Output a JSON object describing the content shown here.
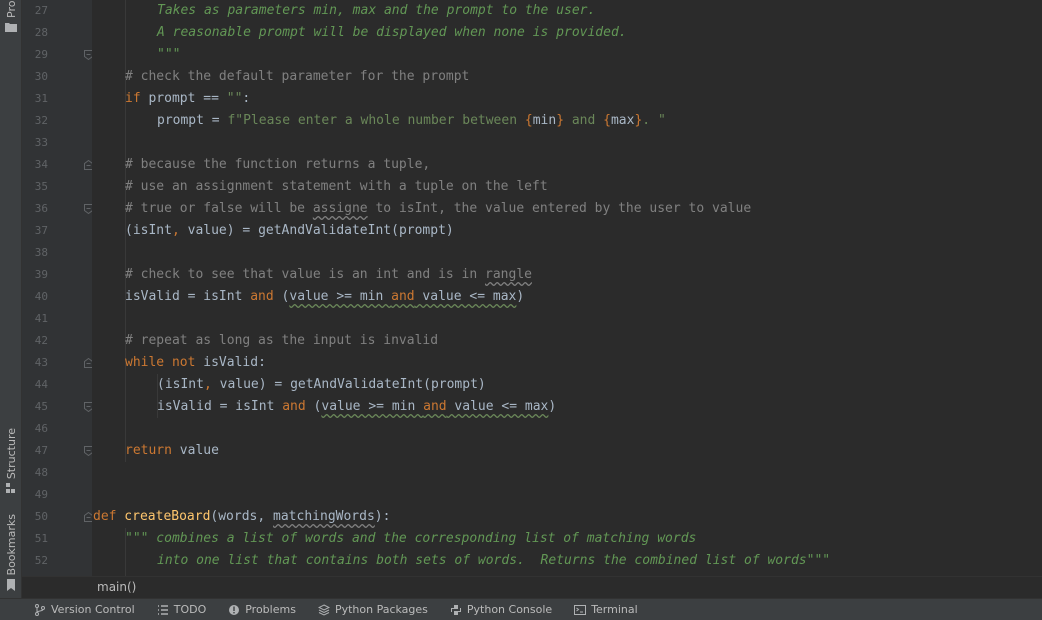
{
  "left_strip": {
    "project_label": "Pro",
    "structure_label": "Structure",
    "bookmarks_label": "Bookmarks"
  },
  "lines": [
    {
      "n": "27"
    },
    {
      "n": "28"
    },
    {
      "n": "29"
    },
    {
      "n": "30"
    },
    {
      "n": "31"
    },
    {
      "n": "32"
    },
    {
      "n": "33"
    },
    {
      "n": "34"
    },
    {
      "n": "35"
    },
    {
      "n": "36"
    },
    {
      "n": "37"
    },
    {
      "n": "38"
    },
    {
      "n": "39"
    },
    {
      "n": "40"
    },
    {
      "n": "41"
    },
    {
      "n": "42"
    },
    {
      "n": "43"
    },
    {
      "n": "44"
    },
    {
      "n": "45"
    },
    {
      "n": "46"
    },
    {
      "n": "47"
    },
    {
      "n": "48"
    },
    {
      "n": "49"
    },
    {
      "n": "50"
    },
    {
      "n": "51"
    },
    {
      "n": "52"
    }
  ],
  "code": {
    "l27": "Takes as parameters min, max and the prompt to the user.",
    "l28": "A reasonable prompt will be displayed when none is provided.",
    "l29": "\"\"\"",
    "l30": "# check the default parameter for the prompt",
    "l31_kw": "if",
    "l31_rest": " prompt == ",
    "l31_str": "\"\"",
    "l31_end": ":",
    "l32_a": "prompt = ",
    "l32_s1": "f\"Please enter a whole number between ",
    "l32_b1": "{",
    "l32_v1": "min",
    "l32_b2": "}",
    "l32_s2": " and ",
    "l32_b3": "{",
    "l32_v2": "max",
    "l32_b4": "}",
    "l32_s3": ". \"",
    "l34": "# because the function returns a tuple,",
    "l35": "# use an assignment statement with a tuple on the left",
    "l36_a": "# true or false will be ",
    "l36_sq": "assigne",
    "l36_b": " to isInt, the value entered by the user to value",
    "l37_a": "(isInt",
    "l37_c": ",",
    "l37_b": " value) = getAndValidateInt(prompt)",
    "l39_a": "# check to see that value is an int and is in ",
    "l39_sq": "rangle",
    "l40_a": "isValid = isInt ",
    "l40_kw1": "and",
    "l40_b": " (",
    "l40_sq1": "value >= min ",
    "l40_kw2": "and",
    "l40_sq2": " value <= max",
    "l40_c": ")",
    "l42": "# repeat as long as the input is invalid",
    "l43_kw": "while not",
    "l43_rest": " isValid:",
    "l44_a": "(isInt",
    "l44_c": ",",
    "l44_b": " value) = getAndValidateInt(prompt)",
    "l45_a": "isValid = isInt ",
    "l45_kw1": "and",
    "l45_b": " (",
    "l45_sq1": "value >= min ",
    "l45_kw2": "and",
    "l45_sq2": " value <= max",
    "l45_c": ")",
    "l47_kw": "return",
    "l47_rest": " value",
    "l50_kw": "def",
    "l50_fn": " createBoard",
    "l50_a": "(words, ",
    "l50_sq": "matchingWords",
    "l50_b": "):",
    "l51": "\"\"\" combines a list of words and the corresponding list of matching words",
    "l52": "into one list that contains both sets of words.  Returns the combined list of words\"\"\""
  },
  "breadcrumb": "main()",
  "bottom_tabs": [
    {
      "label": "Version Control",
      "icon": "branch-icon"
    },
    {
      "label": "TODO",
      "icon": "list-icon"
    },
    {
      "label": "Problems",
      "icon": "warning-icon"
    },
    {
      "label": "Python Packages",
      "icon": "layers-icon"
    },
    {
      "label": "Python Console",
      "icon": "python-icon"
    },
    {
      "label": "Terminal",
      "icon": "terminal-icon"
    }
  ],
  "colors": {
    "editor_bg": "#2b2b2b",
    "gutter_bg": "#313335",
    "docstring": "#629755",
    "comment": "#808080",
    "keyword": "#cc7832",
    "function": "#ffc66d",
    "default_text": "#a9b7c6"
  }
}
